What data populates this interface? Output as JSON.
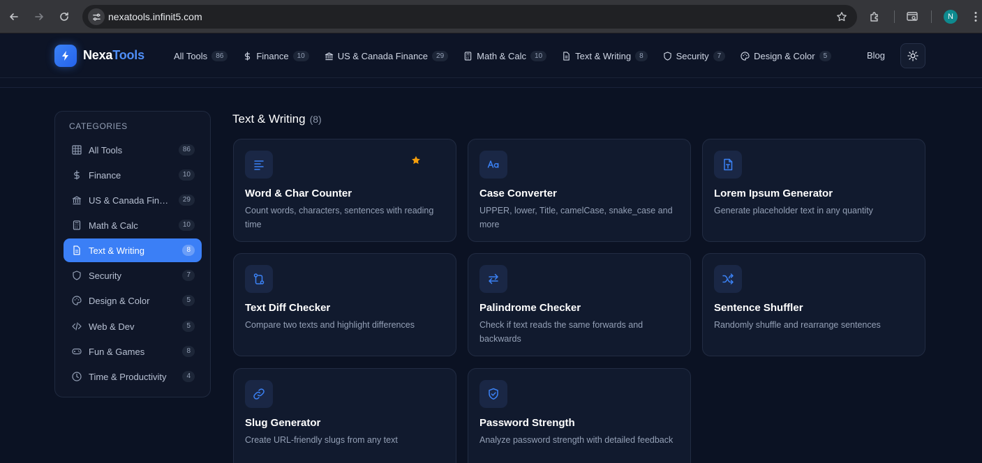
{
  "browser": {
    "url": "nexatools.infinit5.com",
    "profile_initial": "N"
  },
  "header": {
    "logo_part1": "Nexa",
    "logo_part2": "Tools",
    "nav": [
      {
        "label": "All Tools",
        "count": "86",
        "icon": "grid-icon"
      },
      {
        "label": "Finance",
        "count": "10",
        "icon": "dollar-icon"
      },
      {
        "label": "US & Canada Finance",
        "count": "29",
        "icon": "bank-icon"
      },
      {
        "label": "Math & Calc",
        "count": "10",
        "icon": "calculator-icon"
      },
      {
        "label": "Text & Writing",
        "count": "8",
        "icon": "document-icon"
      },
      {
        "label": "Security",
        "count": "7",
        "icon": "shield-icon"
      },
      {
        "label": "Design & Color",
        "count": "5",
        "icon": "palette-icon"
      }
    ],
    "blog_label": "Blog"
  },
  "sidebar": {
    "heading": "CATEGORIES",
    "items": [
      {
        "label": "All Tools",
        "count": "86",
        "icon": "grid-icon"
      },
      {
        "label": "Finance",
        "count": "10",
        "icon": "dollar-icon"
      },
      {
        "label": "US & Canada Finance",
        "count": "29",
        "icon": "bank-icon"
      },
      {
        "label": "Math & Calc",
        "count": "10",
        "icon": "calculator-icon"
      },
      {
        "label": "Text & Writing",
        "count": "8",
        "icon": "document-icon",
        "active": true
      },
      {
        "label": "Security",
        "count": "7",
        "icon": "shield-icon"
      },
      {
        "label": "Design & Color",
        "count": "5",
        "icon": "palette-icon"
      },
      {
        "label": "Web & Dev",
        "count": "5",
        "icon": "code-icon"
      },
      {
        "label": "Fun & Games",
        "count": "8",
        "icon": "gamepad-icon"
      },
      {
        "label": "Time & Productivity",
        "count": "4",
        "icon": "clock-icon"
      }
    ]
  },
  "main": {
    "title": "Text & Writing",
    "count": "(8)",
    "cards": [
      {
        "title": "Word & Char Counter",
        "desc": "Count words, characters, sentences with reading time",
        "icon": "text-lines-icon",
        "favorite": true
      },
      {
        "title": "Case Converter",
        "desc": "UPPER, lower, Title, camelCase, snake_case and more",
        "icon": "case-icon"
      },
      {
        "title": "Lorem Ipsum Generator",
        "desc": "Generate placeholder text in any quantity",
        "icon": "file-text-icon"
      },
      {
        "title": "Text Diff Checker",
        "desc": "Compare two texts and highlight differences",
        "icon": "diff-icon"
      },
      {
        "title": "Palindrome Checker",
        "desc": "Check if text reads the same forwards and backwards",
        "icon": "arrows-swap-icon"
      },
      {
        "title": "Sentence Shuffler",
        "desc": "Randomly shuffle and rearrange sentences",
        "icon": "shuffle-icon"
      },
      {
        "title": "Slug Generator",
        "desc": "Create URL-friendly slugs from any text",
        "icon": "link-icon"
      },
      {
        "title": "Password Strength",
        "desc": "Analyze password strength with detailed feedback",
        "icon": "shield-check-icon"
      }
    ]
  },
  "colors": {
    "accent": "#3b7ff6",
    "favorite_star": "#f59e0b",
    "page_bg": "#0b1223",
    "card_bg": "#111a2e"
  }
}
